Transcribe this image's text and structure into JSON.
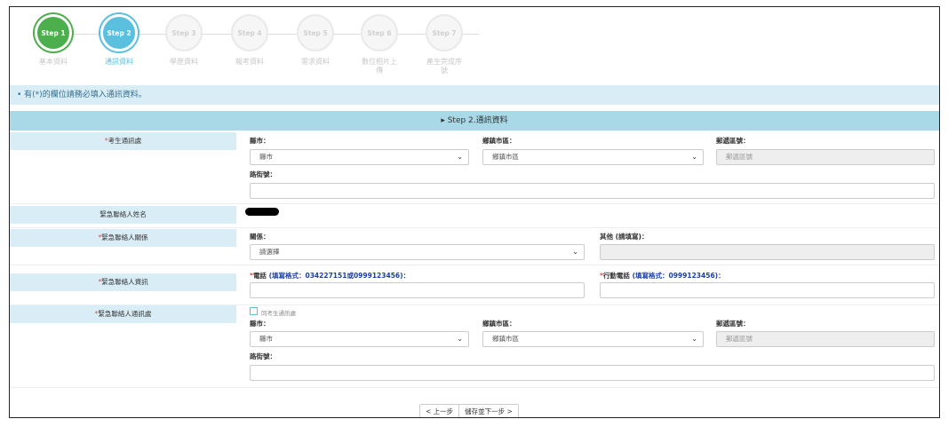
{
  "steps": [
    {
      "circle": "Step 1",
      "label": "基本資料",
      "state": "done"
    },
    {
      "circle": "Step 2",
      "label": "通訊資料",
      "state": "active"
    },
    {
      "circle": "Step 3",
      "label": "學歷資料",
      "state": "todo"
    },
    {
      "circle": "Step 4",
      "label": "報考資料",
      "state": "todo"
    },
    {
      "circle": "Step 5",
      "label": "需求資料",
      "state": "todo"
    },
    {
      "circle": "Step 6",
      "label": "數位相片上傳",
      "state": "todo"
    },
    {
      "circle": "Step 7",
      "label": "產生完成序號",
      "state": "todo"
    }
  ],
  "notice": "• 有(*)的欄位請務必填入通訊資料。",
  "section_title": "▸ Step 2.通訊資料",
  "rows": {
    "address": {
      "label": "考生通訊處",
      "county_label": "縣市：",
      "county_value": "縣市",
      "town_label": "鄉鎮市區：",
      "town_value": "鄉鎮市區",
      "zip_label": "郵遞區號：",
      "zip_placeholder": "郵遞區號",
      "street_label": "路街號："
    },
    "contact_name": {
      "label": "緊急聯絡人姓名"
    },
    "relation": {
      "label": "緊急聯絡人關係",
      "relation_label": "關係：",
      "relation_value": "請選擇",
      "other_label": "其他 (請填寫)："
    },
    "contact_info": {
      "label": "緊急聯絡人資訊",
      "phone_label": "電話",
      "phone_hint": "(填寫格式：034227151或0999123456)",
      "phone_colon": "：",
      "mobile_label": "行動電話",
      "mobile_hint": "(填寫格式：0999123456)",
      "mobile_colon": "："
    },
    "contact_address": {
      "label": "緊急聯絡人通訊處",
      "same_label": "同考生通訊處",
      "county_label": "縣市：",
      "county_value": "縣市",
      "town_label": "鄉鎮市區：",
      "town_value": "鄉鎮市區",
      "zip_label": "郵遞區號：",
      "zip_placeholder": "郵遞區號",
      "street_label": "路街號："
    }
  },
  "buttons": {
    "prev": "< 上一步",
    "next": "儲存並下一步 >"
  },
  "required_mark": "*",
  "colors": {
    "done": "#4cae4c",
    "active": "#5bc0de",
    "notice_bg": "#d9edf7",
    "section_bg": "#a9d8e6",
    "required": "#d9534f",
    "hint": "#1a3fa8"
  }
}
